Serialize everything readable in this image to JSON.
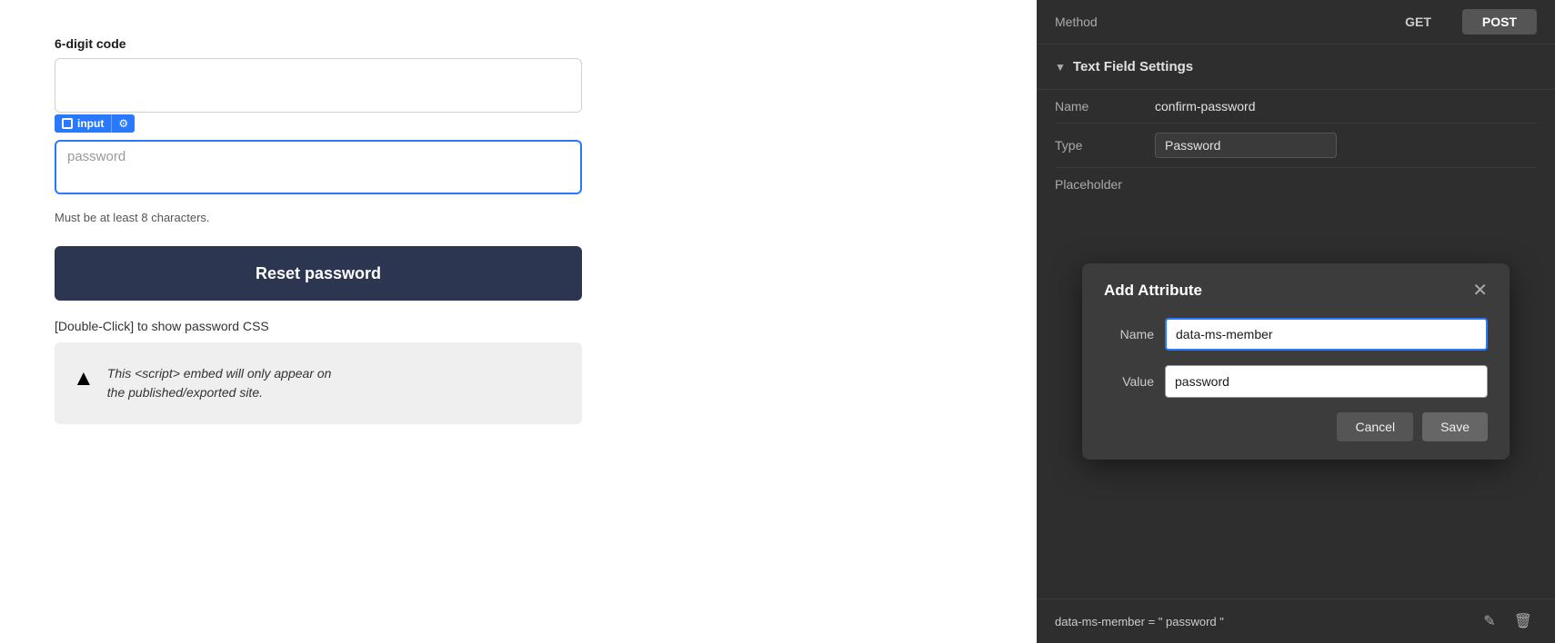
{
  "left": {
    "code_label": "6-digit code",
    "password_label": "password",
    "badge_input_text": "input",
    "helper_text": "Must be at least 8 characters.",
    "reset_button": "Reset password",
    "double_click_label": "[Double-Click] to show password CSS",
    "script_notice": "This <script> embed will only appear on the published/exported site."
  },
  "right": {
    "method_label": "Method",
    "get_label": "GET",
    "post_label": "POST",
    "settings_title": "Text Field Settings",
    "name_key": "Name",
    "name_value": "confirm-password",
    "type_key": "Type",
    "type_value": "Password",
    "placeholder_key": "Placeholder",
    "placeholder_value": ""
  },
  "dialog": {
    "title": "Add Attribute",
    "close_icon": "✕",
    "name_label": "Name",
    "name_value": "data-ms-member",
    "value_label": "Value",
    "value_value": "password",
    "cancel_label": "Cancel",
    "save_label": "Save"
  },
  "attribute_row": {
    "text": "data-ms-member = \" password \"",
    "edit_icon": "✎",
    "delete_icon": "🗑"
  }
}
